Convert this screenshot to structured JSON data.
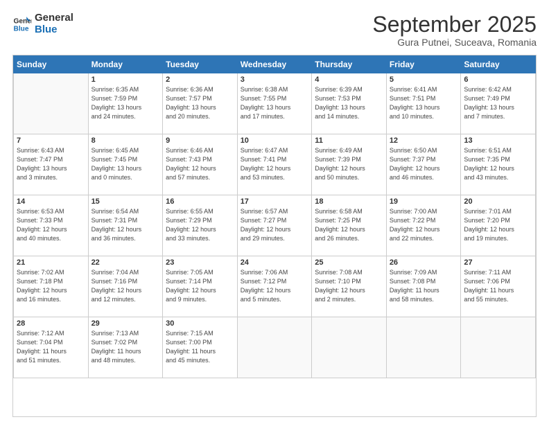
{
  "logo": {
    "line1": "General",
    "line2": "Blue"
  },
  "title": "September 2025",
  "location": "Gura Putnei, Suceava, Romania",
  "weekdays": [
    "Sunday",
    "Monday",
    "Tuesday",
    "Wednesday",
    "Thursday",
    "Friday",
    "Saturday"
  ],
  "weeks": [
    [
      {
        "day": "",
        "info": ""
      },
      {
        "day": "1",
        "info": "Sunrise: 6:35 AM\nSunset: 7:59 PM\nDaylight: 13 hours\nand 24 minutes."
      },
      {
        "day": "2",
        "info": "Sunrise: 6:36 AM\nSunset: 7:57 PM\nDaylight: 13 hours\nand 20 minutes."
      },
      {
        "day": "3",
        "info": "Sunrise: 6:38 AM\nSunset: 7:55 PM\nDaylight: 13 hours\nand 17 minutes."
      },
      {
        "day": "4",
        "info": "Sunrise: 6:39 AM\nSunset: 7:53 PM\nDaylight: 13 hours\nand 14 minutes."
      },
      {
        "day": "5",
        "info": "Sunrise: 6:41 AM\nSunset: 7:51 PM\nDaylight: 13 hours\nand 10 minutes."
      },
      {
        "day": "6",
        "info": "Sunrise: 6:42 AM\nSunset: 7:49 PM\nDaylight: 13 hours\nand 7 minutes."
      }
    ],
    [
      {
        "day": "7",
        "info": "Sunrise: 6:43 AM\nSunset: 7:47 PM\nDaylight: 13 hours\nand 3 minutes."
      },
      {
        "day": "8",
        "info": "Sunrise: 6:45 AM\nSunset: 7:45 PM\nDaylight: 13 hours\nand 0 minutes."
      },
      {
        "day": "9",
        "info": "Sunrise: 6:46 AM\nSunset: 7:43 PM\nDaylight: 12 hours\nand 57 minutes."
      },
      {
        "day": "10",
        "info": "Sunrise: 6:47 AM\nSunset: 7:41 PM\nDaylight: 12 hours\nand 53 minutes."
      },
      {
        "day": "11",
        "info": "Sunrise: 6:49 AM\nSunset: 7:39 PM\nDaylight: 12 hours\nand 50 minutes."
      },
      {
        "day": "12",
        "info": "Sunrise: 6:50 AM\nSunset: 7:37 PM\nDaylight: 12 hours\nand 46 minutes."
      },
      {
        "day": "13",
        "info": "Sunrise: 6:51 AM\nSunset: 7:35 PM\nDaylight: 12 hours\nand 43 minutes."
      }
    ],
    [
      {
        "day": "14",
        "info": "Sunrise: 6:53 AM\nSunset: 7:33 PM\nDaylight: 12 hours\nand 40 minutes."
      },
      {
        "day": "15",
        "info": "Sunrise: 6:54 AM\nSunset: 7:31 PM\nDaylight: 12 hours\nand 36 minutes."
      },
      {
        "day": "16",
        "info": "Sunrise: 6:55 AM\nSunset: 7:29 PM\nDaylight: 12 hours\nand 33 minutes."
      },
      {
        "day": "17",
        "info": "Sunrise: 6:57 AM\nSunset: 7:27 PM\nDaylight: 12 hours\nand 29 minutes."
      },
      {
        "day": "18",
        "info": "Sunrise: 6:58 AM\nSunset: 7:25 PM\nDaylight: 12 hours\nand 26 minutes."
      },
      {
        "day": "19",
        "info": "Sunrise: 7:00 AM\nSunset: 7:22 PM\nDaylight: 12 hours\nand 22 minutes."
      },
      {
        "day": "20",
        "info": "Sunrise: 7:01 AM\nSunset: 7:20 PM\nDaylight: 12 hours\nand 19 minutes."
      }
    ],
    [
      {
        "day": "21",
        "info": "Sunrise: 7:02 AM\nSunset: 7:18 PM\nDaylight: 12 hours\nand 16 minutes."
      },
      {
        "day": "22",
        "info": "Sunrise: 7:04 AM\nSunset: 7:16 PM\nDaylight: 12 hours\nand 12 minutes."
      },
      {
        "day": "23",
        "info": "Sunrise: 7:05 AM\nSunset: 7:14 PM\nDaylight: 12 hours\nand 9 minutes."
      },
      {
        "day": "24",
        "info": "Sunrise: 7:06 AM\nSunset: 7:12 PM\nDaylight: 12 hours\nand 5 minutes."
      },
      {
        "day": "25",
        "info": "Sunrise: 7:08 AM\nSunset: 7:10 PM\nDaylight: 12 hours\nand 2 minutes."
      },
      {
        "day": "26",
        "info": "Sunrise: 7:09 AM\nSunset: 7:08 PM\nDaylight: 11 hours\nand 58 minutes."
      },
      {
        "day": "27",
        "info": "Sunrise: 7:11 AM\nSunset: 7:06 PM\nDaylight: 11 hours\nand 55 minutes."
      }
    ],
    [
      {
        "day": "28",
        "info": "Sunrise: 7:12 AM\nSunset: 7:04 PM\nDaylight: 11 hours\nand 51 minutes."
      },
      {
        "day": "29",
        "info": "Sunrise: 7:13 AM\nSunset: 7:02 PM\nDaylight: 11 hours\nand 48 minutes."
      },
      {
        "day": "30",
        "info": "Sunrise: 7:15 AM\nSunset: 7:00 PM\nDaylight: 11 hours\nand 45 minutes."
      },
      {
        "day": "",
        "info": ""
      },
      {
        "day": "",
        "info": ""
      },
      {
        "day": "",
        "info": ""
      },
      {
        "day": "",
        "info": ""
      }
    ]
  ]
}
